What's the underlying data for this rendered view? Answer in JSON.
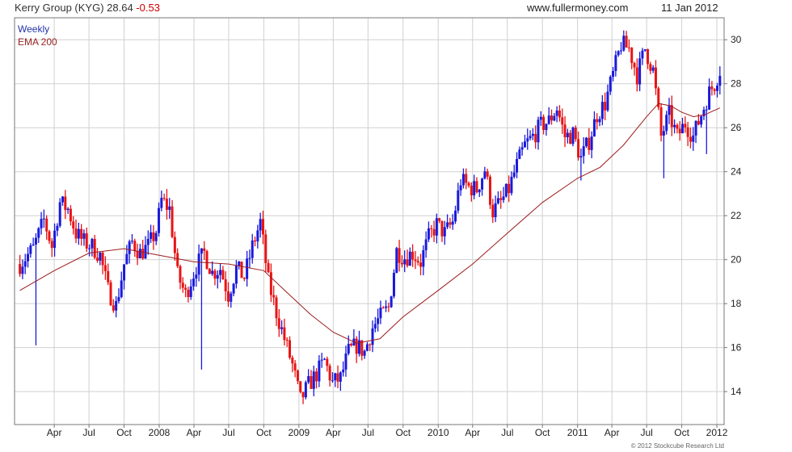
{
  "header": {
    "title": "Kerry Group (KYG) 28.64",
    "change": "-0.53",
    "website": "www.fullermoney.com",
    "date": "11 Jan 2012"
  },
  "legend": {
    "series1": "Weekly",
    "series2": "EMA 200"
  },
  "copyright": "© 2012 Stockcube Research Ltd",
  "colors": {
    "up": "#1a1adc",
    "down": "#e81414",
    "ema": "#9b1b1b",
    "grid": "#d0d0d0"
  },
  "chart_data": {
    "type": "line",
    "ylim": [
      12.5,
      31
    ],
    "y_ticks": [
      "14",
      "16",
      "18",
      "20",
      "22",
      "24",
      "26",
      "28",
      "30"
    ],
    "x_labels": [
      "Apr",
      "Jul",
      "Oct",
      "2008",
      "Apr",
      "Jul",
      "Oct",
      "2009",
      "Apr",
      "Jul",
      "Oct",
      "2010",
      "Apr",
      "Jul",
      "Oct",
      "2011",
      "Apr",
      "Jul",
      "Oct",
      "2012"
    ],
    "grid": true,
    "series": [
      {
        "name": "Weekly",
        "style": "weekly high-low bars, blue = up week, red = down week",
        "points": [
          [
            "2007-01-01",
            19.8
          ],
          [
            "2007-02-05",
            20.5
          ],
          [
            "2007-03-05",
            21.8
          ],
          [
            "2007-03-26",
            20.6
          ],
          [
            "2007-04-16",
            22.6
          ],
          [
            "2007-05-07",
            22.3
          ],
          [
            "2007-05-28",
            21.2
          ],
          [
            "2007-06-18",
            20.8
          ],
          [
            "2007-07-09",
            20.6
          ],
          [
            "2007-07-30",
            20.2
          ],
          [
            "2007-08-20",
            18.6
          ],
          [
            "2007-09-10",
            17.9
          ],
          [
            "2007-10-01",
            19.8
          ],
          [
            "2007-10-22",
            20.8
          ],
          [
            "2007-11-12",
            20.3
          ],
          [
            "2007-12-03",
            20.6
          ],
          [
            "2007-12-24",
            21.3
          ],
          [
            "2008-01-07",
            22.7
          ],
          [
            "2008-01-28",
            22.3
          ],
          [
            "2008-02-18",
            19.3
          ],
          [
            "2008-03-10",
            18.4
          ],
          [
            "2008-04-07",
            19.7
          ],
          [
            "2008-04-28",
            20.3
          ],
          [
            "2008-05-19",
            19.4
          ],
          [
            "2008-06-09",
            19.6
          ],
          [
            "2008-06-30",
            18.4
          ],
          [
            "2008-07-21",
            19.6
          ],
          [
            "2008-08-11",
            19.2
          ],
          [
            "2008-09-01",
            20.6
          ],
          [
            "2008-09-22",
            21.7
          ],
          [
            "2008-10-13",
            19.0
          ],
          [
            "2008-11-03",
            17.6
          ],
          [
            "2008-11-24",
            16.4
          ],
          [
            "2008-12-15",
            15.2
          ],
          [
            "2009-01-05",
            13.6
          ],
          [
            "2009-01-26",
            14.3
          ],
          [
            "2009-02-16",
            14.8
          ],
          [
            "2009-03-09",
            15.4
          ],
          [
            "2009-03-30",
            14.4
          ],
          [
            "2009-04-20",
            14.6
          ],
          [
            "2009-05-11",
            15.8
          ],
          [
            "2009-06-01",
            16.1
          ],
          [
            "2009-06-22",
            15.8
          ],
          [
            "2009-07-13",
            16.9
          ],
          [
            "2009-08-03",
            17.4
          ],
          [
            "2009-08-24",
            17.8
          ],
          [
            "2009-09-14",
            20.4
          ],
          [
            "2009-10-05",
            20.1
          ],
          [
            "2009-10-26",
            20.3
          ],
          [
            "2009-11-16",
            19.9
          ],
          [
            "2009-12-07",
            21.0
          ],
          [
            "2009-12-28",
            21.6
          ],
          [
            "2010-01-18",
            21.2
          ],
          [
            "2010-02-08",
            21.7
          ],
          [
            "2010-03-01",
            23.6
          ],
          [
            "2010-03-22",
            23.3
          ],
          [
            "2010-04-12",
            23.2
          ],
          [
            "2010-05-03",
            24.1
          ],
          [
            "2010-05-24",
            22.2
          ],
          [
            "2010-06-14",
            22.6
          ],
          [
            "2010-07-05",
            23.2
          ],
          [
            "2010-07-26",
            24.3
          ],
          [
            "2010-08-16",
            25.2
          ],
          [
            "2010-09-06",
            25.6
          ],
          [
            "2010-09-27",
            26.1
          ],
          [
            "2010-10-18",
            26.3
          ],
          [
            "2010-11-08",
            26.9
          ],
          [
            "2010-11-29",
            25.6
          ],
          [
            "2010-12-20",
            25.7
          ],
          [
            "2011-01-10",
            24.6
          ],
          [
            "2011-01-31",
            25.4
          ],
          [
            "2011-02-21",
            26.6
          ],
          [
            "2011-03-14",
            27.1
          ],
          [
            "2011-04-04",
            28.4
          ],
          [
            "2011-04-25",
            29.8
          ],
          [
            "2011-05-16",
            29.6
          ],
          [
            "2011-06-06",
            28.4
          ],
          [
            "2011-06-27",
            29.6
          ],
          [
            "2011-07-18",
            28.6
          ],
          [
            "2011-08-08",
            25.6
          ],
          [
            "2011-08-29",
            26.6
          ],
          [
            "2011-09-19",
            25.6
          ],
          [
            "2011-10-10",
            26.2
          ],
          [
            "2011-10-31",
            25.6
          ],
          [
            "2011-11-21",
            26.6
          ],
          [
            "2011-12-12",
            27.6
          ],
          [
            "2011-12-26",
            28.0
          ],
          [
            "2012-01-09",
            28.64
          ]
        ]
      },
      {
        "name": "EMA 200",
        "points": [
          [
            "2007-01-01",
            18.6
          ],
          [
            "2007-04-01",
            19.5
          ],
          [
            "2007-07-01",
            20.3
          ],
          [
            "2007-10-01",
            20.5
          ],
          [
            "2008-01-01",
            20.2
          ],
          [
            "2008-04-01",
            19.9
          ],
          [
            "2008-07-01",
            19.8
          ],
          [
            "2008-10-01",
            19.5
          ],
          [
            "2008-12-01",
            18.5
          ],
          [
            "2009-02-01",
            17.5
          ],
          [
            "2009-04-01",
            16.7
          ],
          [
            "2009-06-01",
            16.2
          ],
          [
            "2009-08-01",
            16.4
          ],
          [
            "2009-10-01",
            17.4
          ],
          [
            "2010-01-01",
            18.6
          ],
          [
            "2010-04-01",
            19.8
          ],
          [
            "2010-07-01",
            21.2
          ],
          [
            "2010-10-01",
            22.6
          ],
          [
            "2011-01-01",
            23.7
          ],
          [
            "2011-03-01",
            24.2
          ],
          [
            "2011-05-01",
            25.2
          ],
          [
            "2011-07-01",
            26.5
          ],
          [
            "2011-08-01",
            27.1
          ],
          [
            "2011-09-01",
            27.0
          ],
          [
            "2011-10-01",
            26.7
          ],
          [
            "2011-11-01",
            26.5
          ],
          [
            "2011-12-01",
            26.6
          ],
          [
            "2012-01-09",
            26.9
          ]
        ]
      }
    ]
  }
}
